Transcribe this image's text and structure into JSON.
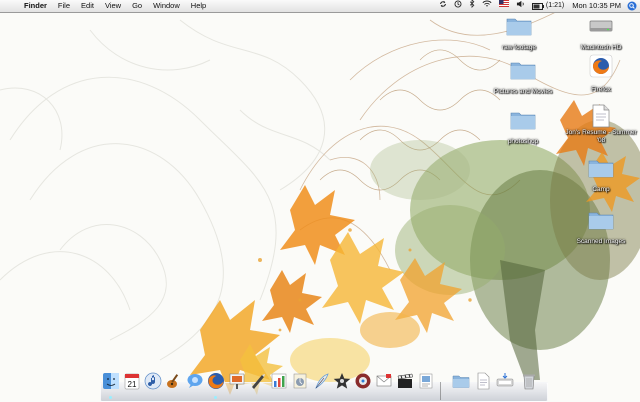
{
  "menubar": {
    "apple_glyph": "",
    "app_name": "Finder",
    "menus": [
      "File",
      "Edit",
      "View",
      "Go",
      "Window",
      "Help"
    ],
    "status_icons": [
      "sync-icon",
      "time-machine-icon",
      "bluetooth-icon",
      "wifi-icon",
      "flag-icon",
      "volume-icon"
    ],
    "battery": "(1:21)",
    "clock": "Mon 10:35 PM"
  },
  "desktop": {
    "icons": [
      {
        "label": "raw footage",
        "icon": "folder-icon"
      },
      {
        "label": "Macintosh HD",
        "icon": "hard-drive-icon"
      },
      {
        "label": "Firefox",
        "icon": "firefox-icon"
      },
      {
        "label": "Pictures and Movies",
        "icon": "folder-icon"
      },
      {
        "label": "photoshop",
        "icon": "folder-icon"
      },
      {
        "label": "Jon's Resume - Summer '08",
        "icon": "document-icon"
      },
      {
        "label": "Camp",
        "icon": "folder-icon"
      },
      {
        "label": "Scanned Images",
        "icon": "folder-icon"
      }
    ]
  },
  "dock": {
    "calendar_day": "21",
    "items": [
      "finder-icon",
      "ical-icon",
      "itunes-icon",
      "garageband-icon",
      "ichat-icon",
      "firefox-icon",
      "keynote-icon",
      "inkscape-icon",
      "charts-icon",
      "script-editor-icon",
      "quill-icon",
      "imovie-icon",
      "automator-icon",
      "mail-icon",
      "clapperboard-icon",
      "preview-icon",
      "quicktime-icon",
      "folder-icon",
      "document-icon",
      "downloads-icon",
      "trash-icon"
    ]
  },
  "colors": {
    "wallpaper_bg": "#fbfbf8",
    "orange": "#f0a020",
    "green": "#5d7a2b",
    "folder_blue": "#8ab4dd"
  }
}
